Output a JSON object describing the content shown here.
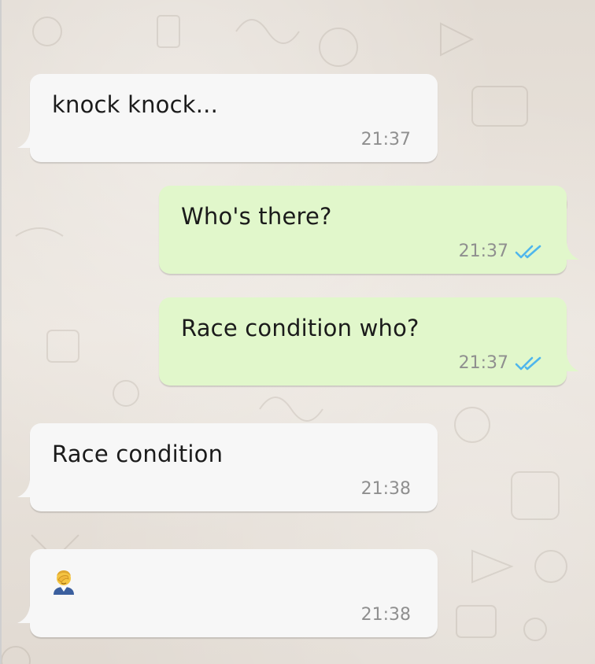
{
  "messages": [
    {
      "direction": "incoming",
      "text": "knock knock...",
      "time": "21:37"
    },
    {
      "direction": "outgoing",
      "text": "Who's there?",
      "time": "21:37",
      "status": "read"
    },
    {
      "direction": "outgoing",
      "text": "Race condition who?",
      "time": "21:37",
      "status": "read"
    },
    {
      "direction": "incoming",
      "text": "Race condition",
      "time": "21:38"
    },
    {
      "direction": "incoming",
      "emoji": "facepalm",
      "time": "21:38"
    }
  ],
  "colors": {
    "incoming_bubble": "#f7f7f7",
    "outgoing_bubble": "#e1f7cb",
    "read_ticks": "#4fb6ec",
    "timestamp": "#8f8f8f",
    "background": "#e5ddd5"
  }
}
